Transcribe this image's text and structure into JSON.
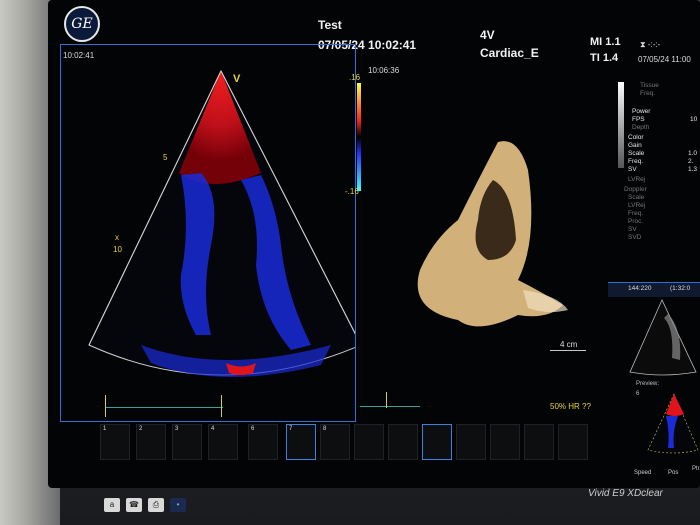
{
  "header": {
    "patient_name": "Test",
    "datetime": "07/05/24 10:02:41",
    "probe": "4V",
    "preset": "Cardiac_E",
    "mi": "MI 1.1",
    "ti": "TI 1.4",
    "right_date": "07/05/24 11:00",
    "right_symbol": "⧗ -:-:-"
  },
  "left_view": {
    "time": "10:02:41",
    "depth_marks": [
      "5",
      "10"
    ],
    "depth_x": "x",
    "sector_marker": "V",
    "scale_top": ".16",
    "scale_bottom": "-.16"
  },
  "center_view": {
    "time": "10:06:36",
    "scale_label": "4 cm",
    "hr_label": "50% HR ??"
  },
  "right_menu": {
    "items": [
      {
        "label": "Tissue",
        "dim": true
      },
      {
        "label": "Freq.",
        "dim": true
      },
      {
        "label": "Power",
        "dim": false,
        "value": ""
      },
      {
        "label": "FPS",
        "dim": false,
        "value": "10"
      },
      {
        "label": "Depth",
        "dim": true
      },
      {
        "label": "Color",
        "dim": false
      },
      {
        "label": "Gain",
        "dim": false
      },
      {
        "label": "Scale",
        "dim": false,
        "value": "1.0"
      },
      {
        "label": "Freq.",
        "dim": false,
        "value": "2."
      },
      {
        "label": "SV",
        "dim": false,
        "value": "1.3"
      },
      {
        "label": "LVRej",
        "dim": true
      },
      {
        "label": "Doppler",
        "dim": true
      },
      {
        "label": "Scale",
        "dim": true
      },
      {
        "label": "LVRej",
        "dim": true
      },
      {
        "label": "Freq.",
        "dim": true
      },
      {
        "label": "Proc.",
        "dim": true
      },
      {
        "label": "SV",
        "dim": true
      },
      {
        "label": "SVD",
        "dim": true
      }
    ],
    "slice_label": "144:220",
    "slice_label2": "(1:32:0",
    "preview_label": "Preview:",
    "preview_num": "6"
  },
  "thumbnails": [
    {
      "num": "1"
    },
    {
      "num": "2"
    },
    {
      "num": "3"
    },
    {
      "num": "4"
    },
    {
      "num": "6"
    },
    {
      "num": "7"
    },
    {
      "num": "8"
    }
  ],
  "bottom": {
    "speed": "Speed",
    "pos": "Pos",
    "ptr": "Ptr",
    "brand": "Vivid E9 XDclear",
    "toolbar": [
      "a",
      "☎",
      "⎙",
      "•"
    ]
  },
  "colors": {
    "accent_blue": "#2f6fd8",
    "doppler_red": "#e0141a",
    "doppler_blue": "#1a2bd8",
    "tissue_gold": "#d7b98a"
  }
}
